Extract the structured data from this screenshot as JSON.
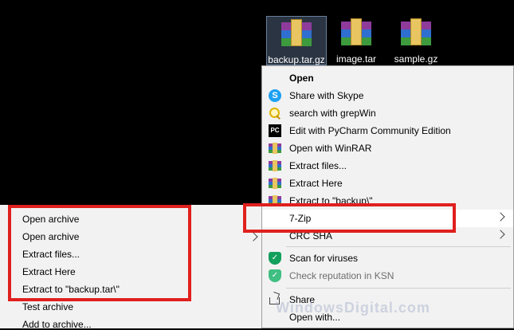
{
  "desktop": {
    "files": [
      {
        "label": "backup.tar.gz",
        "selected": true
      },
      {
        "label": "image.tar",
        "selected": false
      },
      {
        "label": "sample.gz",
        "selected": false
      }
    ]
  },
  "context_menu": {
    "items": [
      {
        "label": "Open",
        "icon": "none"
      },
      {
        "label": "Share with Skype",
        "icon": "skype-icon"
      },
      {
        "label": "search with grepWin",
        "icon": "search-icon"
      },
      {
        "label": "Edit with PyCharm Community Edition",
        "icon": "pycharm-icon"
      },
      {
        "label": "Open with WinRAR",
        "icon": "winrar-icon"
      },
      {
        "label": "Extract files...",
        "icon": "winrar-icon"
      },
      {
        "label": "Extract Here",
        "icon": "winrar-icon"
      },
      {
        "label": "Extract to \"backup\\\"",
        "icon": "winrar-icon"
      },
      {
        "label": "7-Zip",
        "icon": "none"
      },
      {
        "label": "CRC SHA",
        "icon": "none"
      },
      {
        "label": "Scan for viruses",
        "icon": "shield-icon"
      },
      {
        "label": "Check reputation in KSN",
        "icon": "shield-icon"
      },
      {
        "label": "Share",
        "icon": "share-icon"
      },
      {
        "label": "Open with...",
        "icon": "none"
      }
    ]
  },
  "submenu": {
    "items": [
      "Open archive",
      "Open archive",
      "Extract files...",
      "Extract Here",
      "Extract to \"backup.tar\\\"",
      "Test archive",
      "Add to archive..."
    ]
  },
  "watermark": "WindowsDigital.com",
  "colors": {
    "highlight_box": "#e0201e",
    "menu_bg": "#f2f2f2"
  }
}
